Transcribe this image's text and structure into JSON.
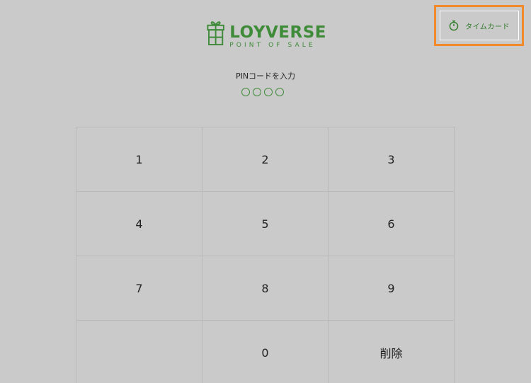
{
  "header": {
    "timecard": {
      "label": "タイムカード",
      "icon": "stopwatch-icon",
      "highlight_color": "#f08a2a",
      "text_color": "#2f7b2a"
    }
  },
  "logo": {
    "brand": "LOYVERSE",
    "tagline": "POINT OF SALE",
    "color": "#3f8b3a"
  },
  "pin": {
    "prompt": "PINコードを入力",
    "length": 4,
    "filled": 0
  },
  "keypad": {
    "keys": [
      {
        "label": "1"
      },
      {
        "label": "2"
      },
      {
        "label": "3"
      },
      {
        "label": "4"
      },
      {
        "label": "5"
      },
      {
        "label": "6"
      },
      {
        "label": "7"
      },
      {
        "label": "8"
      },
      {
        "label": "9"
      },
      {
        "label": ""
      },
      {
        "label": "0"
      },
      {
        "label": "削除"
      }
    ]
  },
  "colors": {
    "background": "#cacaca",
    "grid_line": "#b9b9b9"
  }
}
